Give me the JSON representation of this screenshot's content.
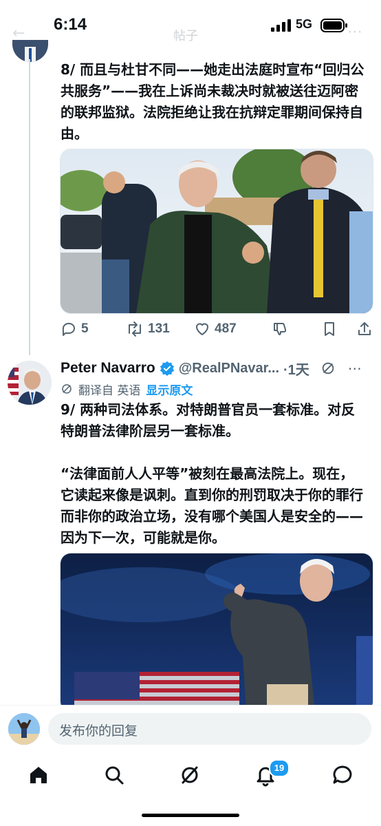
{
  "status_bar": {
    "time": "6:14",
    "network": "5G"
  },
  "nav": {
    "title": "帖子"
  },
  "tweet8": {
    "text": "8/ 而且与杜甘不同——她走出法庭时宣布“回归公共服务”——我在上诉尚未裁决时就被送往迈阿密的联邦监狱。法院拒绝让我在抗辩定罪期间保持自由。",
    "replies": "5",
    "reposts": "131",
    "likes": "487"
  },
  "tweet9": {
    "author": "Peter Navarro",
    "handle": "@RealPNavar...",
    "time": "·1天",
    "translated_label": "翻译自 英语",
    "show_original": "显示原文",
    "text": "9/ 两种司法体系。对特朗普官员一套标准。对反特朗普法律阶层另一套标准。\n\n“法律面前人人平等”被刻在最高法院上。现在，它读起来像是讽刺。直到你的刑罚取决于你的罪行而非你的政治立场，没有哪个美国人是安全的——因为下一次，可能就是你。"
  },
  "reply_bar": {
    "placeholder": "发布你的回复"
  },
  "tabbar": {
    "notification_count": "19"
  },
  "colors": {
    "accent": "#1d9bf0",
    "text": "#0f1419",
    "secondary": "#536471",
    "verified": "#1d9bf0"
  }
}
